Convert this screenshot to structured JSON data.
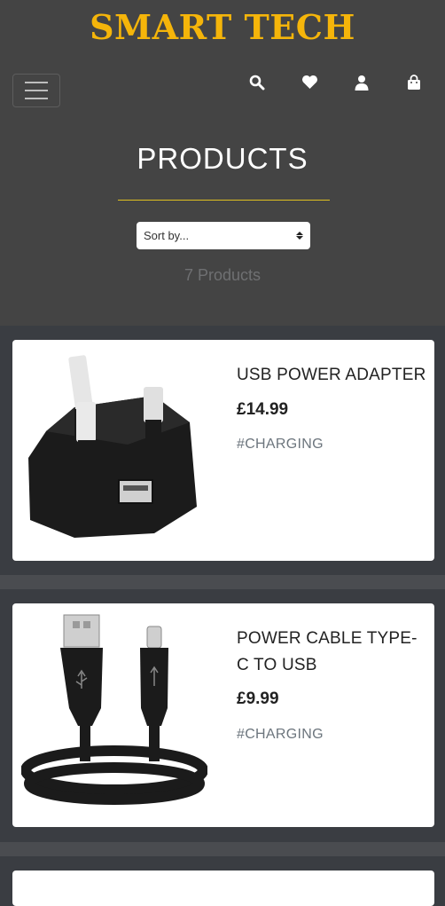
{
  "header": {
    "brand": "SMART TECH",
    "nav_icons": [
      "search-icon",
      "heart-icon",
      "user-icon",
      "shopping-bag-icon"
    ]
  },
  "page": {
    "title": "PRODUCTS",
    "sort_placeholder": "Sort by...",
    "count_text": "7 Products"
  },
  "products": [
    {
      "title": "USB POWER ADAPTER",
      "price": "£14.99",
      "tag": "#CHARGING"
    },
    {
      "title": "POWER CABLE TYPE-C TO USB",
      "price": "£9.99",
      "tag": "#CHARGING"
    }
  ],
  "colors": {
    "brand": "#f5b50a",
    "header_bg": "#444444",
    "page_bg": "#3a3d42"
  }
}
